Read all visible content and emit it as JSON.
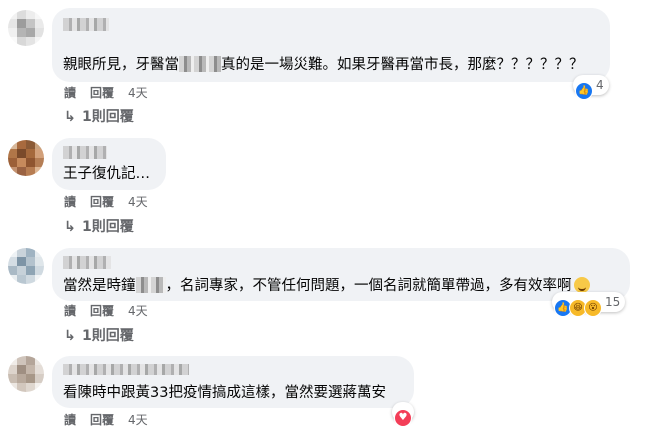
{
  "actions": {
    "read": "讀",
    "reply": "回覆"
  },
  "comments": [
    {
      "text_before": "親眼所見，牙醫當",
      "text_after": "真的是一場災難。如果牙醫再當市長，那麼？？？？？？",
      "time": "4天",
      "reaction_count": "4",
      "replies_label": "1則回覆"
    },
    {
      "text": "王子復仇記…",
      "time": "4天",
      "replies_label": "1則回覆"
    },
    {
      "text_before": "當然是時鐘",
      "text_after": "，名詞專家，不管任何問題，一個名詞就簡單帶過，多有效率啊",
      "time": "4天",
      "reaction_count": "15",
      "replies_label": "1則回覆"
    },
    {
      "text": "看陳時中跟黃33把疫情搞成這樣，當然要選蔣萬安",
      "time": "4天"
    }
  ],
  "icons": {
    "reply_arrow": "↳",
    "like": "👍",
    "haha": "😆",
    "wow": "😮",
    "love": "♥"
  },
  "colors": {
    "bubble_bg": "#f0f2f5",
    "secondary_text": "#65676b",
    "like_blue": "#1877f2",
    "love_red": "#f33e58"
  }
}
